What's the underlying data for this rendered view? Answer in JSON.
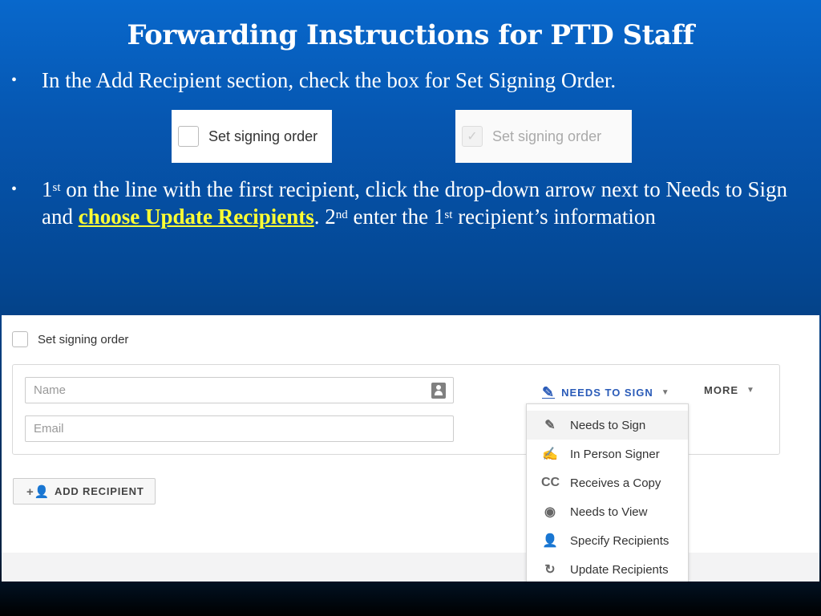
{
  "slide": {
    "title": "Forwarding Instructions for PTD Staff",
    "bullet_glyph": "•",
    "bullet1": "In the Add Recipient section, check the box for Set Signing Order.",
    "bullet2": {
      "p1_num": "1",
      "p1_sup": "st",
      "p1_text": "  on the line with the first recipient, click the drop-down arrow next to Needs to Sign and ",
      "highlight": "choose Update Recipients",
      "p2_pre": ". 2",
      "p2_sup": "nd",
      "p2_text": " enter the 1",
      "p3_sup": "st",
      "p3_text": " recipient’s information"
    },
    "highlight_color": "#ffff33"
  },
  "snippets": {
    "unchecked_label": "Set signing order",
    "checked_label": "Set signing order",
    "check_glyph": "✓"
  },
  "app": {
    "set_order_label": "Set signing order",
    "name_placeholder": "Name",
    "email_placeholder": "Email",
    "role_label": "NEEDS TO SIGN",
    "role_icon": "✎",
    "more_label": "MORE",
    "caret": "▼",
    "add_recipient_label": "ADD RECIPIENT",
    "add_recipient_icon": "+👤",
    "accent_color": "#2a5bb8",
    "role_menu": [
      {
        "icon": "✎",
        "icon_name": "pen-icon",
        "label": "Needs to Sign"
      },
      {
        "icon": "✍",
        "icon_name": "in-person-signer-icon",
        "label": "In Person Signer"
      },
      {
        "icon": "CC",
        "icon_name": "cc-icon",
        "label": "Receives a Copy"
      },
      {
        "icon": "◉",
        "icon_name": "eye-icon",
        "label": "Needs to View"
      },
      {
        "icon": "👤",
        "icon_name": "person-icon",
        "label": "Specify Recipients"
      },
      {
        "icon": "↻",
        "icon_name": "update-recipients-icon",
        "label": "Update Recipients"
      }
    ]
  }
}
